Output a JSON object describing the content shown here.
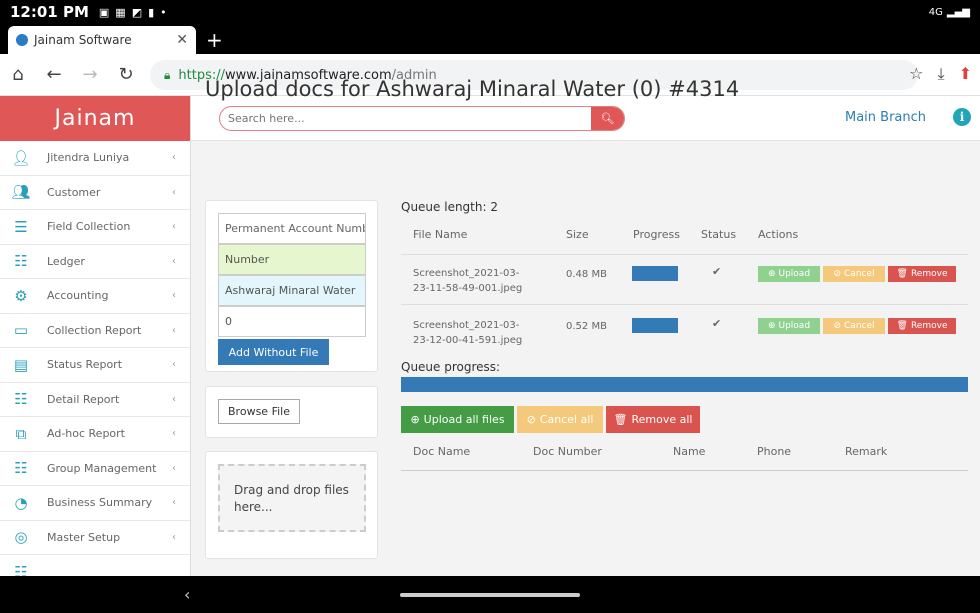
{
  "status": {
    "time": "12:01 PM",
    "network": "4G"
  },
  "browser": {
    "tab_title": "Jainam Software",
    "new_tab": "+",
    "url_proto": "https://",
    "url_host": "www.jainamsoftware.com",
    "url_path": "/admin"
  },
  "app": {
    "brand": "Jainam",
    "search_placeholder": "Search here...",
    "branch": "Main Branch",
    "info": "i"
  },
  "sidebar": {
    "items": [
      {
        "label": "Jitendra Luniya",
        "icon": "user-icon"
      },
      {
        "label": "Customer",
        "icon": "users-icon"
      },
      {
        "label": "Field Collection",
        "icon": "server-icon"
      },
      {
        "label": "Ledger",
        "icon": "list-icon"
      },
      {
        "label": "Accounting",
        "icon": "gear-icon"
      },
      {
        "label": "Collection Report",
        "icon": "money-icon"
      },
      {
        "label": "Status Report",
        "icon": "id-card-icon"
      },
      {
        "label": "Detail Report",
        "icon": "list-icon"
      },
      {
        "label": "Ad-hoc Report",
        "icon": "object-group-icon"
      },
      {
        "label": "Group Management",
        "icon": "list-icon"
      },
      {
        "label": "Business Summary",
        "icon": "dashboard-icon"
      },
      {
        "label": "Master Setup",
        "icon": "life-ring-icon"
      }
    ]
  },
  "page": {
    "title": "Upload docs for Ashwaraj Minaral Water (0) #4314",
    "form": {
      "pan_placeholder": "Permanent Account Number",
      "number_value": "Number",
      "name_value": "Ashwaraj Minaral Water",
      "amount_value": "0",
      "add_without_file": "Add Without File"
    },
    "browse_file": "Browse File",
    "dropzone": "Drag and drop files here...",
    "queue_length": "Queue length: 2",
    "queue_headers": [
      "File Name",
      "Size",
      "Progress",
      "Status",
      "Actions"
    ],
    "files": [
      {
        "name": "Screenshot_2021-03-23-11-58-49-001.jpeg",
        "name_l1": "Screenshot_2021-03-",
        "name_l2": "23-11-58-49-001.jpeg",
        "size": "0.48 MB",
        "progress": 100,
        "status": "✔"
      },
      {
        "name": "Screenshot_2021-03-23-12-00-41-591.jpeg",
        "name_l1": "Screenshot_2021-03-",
        "name_l2": "23-12-00-41-591.jpeg",
        "size": "0.52 MB",
        "progress": 100,
        "status": "✔"
      }
    ],
    "actions": {
      "upload": "Upload",
      "cancel": "Cancel",
      "remove": "Remove"
    },
    "queue_progress_label": "Queue progress:",
    "queue_progress": 100,
    "bulk": {
      "upload_all": "Upload all files",
      "cancel_all": "Cancel all",
      "remove_all": "Remove all"
    },
    "doc_headers": [
      "Doc Name",
      "Doc Number",
      "Name",
      "Phone",
      "Remark"
    ]
  },
  "colors": {
    "brand": "#e05757",
    "primary": "#337ab7",
    "success": "#5cb85c",
    "warning": "#f0ad4e",
    "danger": "#d9534f"
  }
}
